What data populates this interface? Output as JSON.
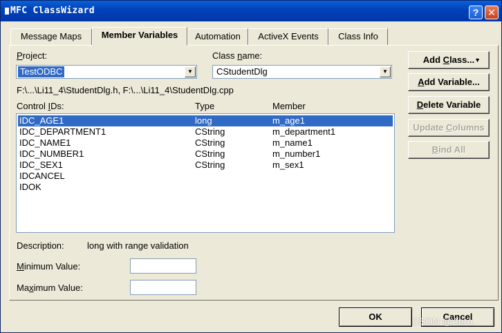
{
  "window": {
    "title": "MFC ClassWizard",
    "help": "?",
    "close": "✕"
  },
  "tabs": [
    {
      "label": "Message Maps"
    },
    {
      "label": "Member Variables"
    },
    {
      "label": "Automation"
    },
    {
      "label": "ActiveX Events"
    },
    {
      "label": "Class Info"
    }
  ],
  "project": {
    "label_pre": "",
    "label_u": "P",
    "label_post": "roject:",
    "value": "TestODBC"
  },
  "class_name": {
    "label_pre": "Class ",
    "label_u": "n",
    "label_post": "ame:",
    "value": "CStudentDlg"
  },
  "file_path": "F:\\...\\Li11_4\\StudentDlg.h, F:\\...\\Li11_4\\StudentDlg.cpp",
  "list": {
    "headers": {
      "control_ids_pre": "Control ",
      "control_ids_u": "I",
      "control_ids_post": "Ds:",
      "type": "Type",
      "member": "Member"
    },
    "rows": [
      {
        "id": "IDC_AGE1",
        "type": "long",
        "member": "m_age1"
      },
      {
        "id": "IDC_DEPARTMENT1",
        "type": "CString",
        "member": "m_department1"
      },
      {
        "id": "IDC_NAME1",
        "type": "CString",
        "member": "m_name1"
      },
      {
        "id": "IDC_NUMBER1",
        "type": "CString",
        "member": "m_number1"
      },
      {
        "id": "IDC_SEX1",
        "type": "CString",
        "member": "m_sex1"
      },
      {
        "id": "IDCANCEL",
        "type": "",
        "member": ""
      },
      {
        "id": "IDOK",
        "type": "",
        "member": ""
      }
    ]
  },
  "description": {
    "label": "Description:",
    "value": "long with range validation"
  },
  "minimum": {
    "label_pre": "",
    "label_u": "M",
    "label_post": "inimum Value:",
    "value": ""
  },
  "maximum": {
    "label_pre": "Ma",
    "label_u": "x",
    "label_post": "imum Value:",
    "value": ""
  },
  "buttons": {
    "add_class_pre": "Add ",
    "add_class_u": "C",
    "add_class_post": "lass...",
    "add_class_arrow": "▼",
    "add_variable_pre": "",
    "add_variable_u": "A",
    "add_variable_post": "dd Variable...",
    "delete_variable_pre": "",
    "delete_variable_u": "D",
    "delete_variable_post": "elete Variable",
    "update_columns_pre": "Update ",
    "update_columns_u": "C",
    "update_columns_post": "olumns",
    "bind_all_pre": "",
    "bind_all_u": "B",
    "bind_all_post": "ind All"
  },
  "footer": {
    "ok": "OK",
    "cancel": "Cancel"
  },
  "watermark": "CSDN @Abro."
}
